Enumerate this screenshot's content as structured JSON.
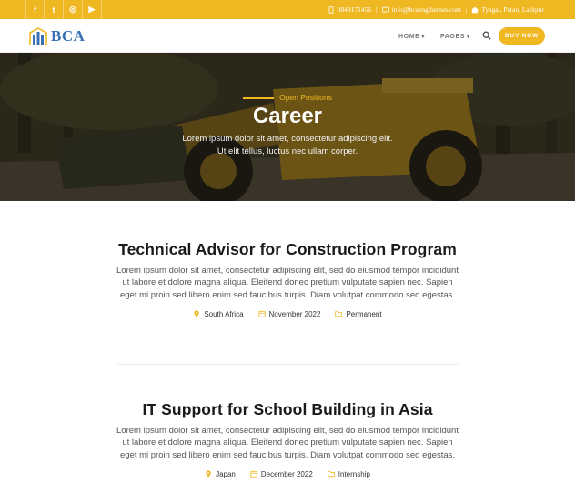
{
  "topbar": {
    "social": [
      {
        "icon": "facebook-icon",
        "glyph": "f"
      },
      {
        "icon": "twitter-icon",
        "glyph": "t"
      },
      {
        "icon": "instagram-icon",
        "glyph": "◎"
      },
      {
        "icon": "youtube-icon",
        "glyph": "▶"
      }
    ],
    "phone": "9849171456",
    "email": "info@bcaengthemes.com",
    "location": "Tyagal, Patan, Lalitpur"
  },
  "header": {
    "logo_text": "BCA",
    "nav": [
      {
        "label": "HOME",
        "chevron": "▾"
      },
      {
        "label": "PAGES",
        "chevron": "▾"
      }
    ],
    "buy_label": "BUY NOW"
  },
  "hero": {
    "eyebrow": "Open Positions",
    "title": "Career",
    "subtitle_line1": "Lorem ipsum dolor sit amet, consectetur adipiscing elit.",
    "subtitle_line2": "Ut elit tellus, luctus nec ullam corper."
  },
  "jobs": [
    {
      "title": "Technical Advisor for Construction Program",
      "description": "Lorem ipsum dolor sit amet, consectetur adipiscing elit, sed do eiusmod tempor incididunt ut labore et dolore magna aliqua. Eleifend donec pretium vulputate sapien nec. Sapien eget mi proin sed libero enim sed faucibus turpis. Diam volutpat commodo sed egestas.",
      "location": "South Africa",
      "date": "November 2022",
      "type": "Permanent"
    },
    {
      "title": "IT Support for School Building in Asia",
      "description": "Lorem ipsum dolor sit amet, consectetur adipiscing elit, sed do eiusmod tempor incididunt ut labore et dolore magna aliqua. Eleifend donec pretium vulputate sapien nec. Sapien eget mi proin sed libero enim sed faucibus turpis. Diam volutpat commodo sed egestas.",
      "location": "Japan",
      "date": "December 2022",
      "type": "Internship"
    }
  ],
  "colors": {
    "accent": "#efb823",
    "logo_blue": "#3a6fb5"
  }
}
